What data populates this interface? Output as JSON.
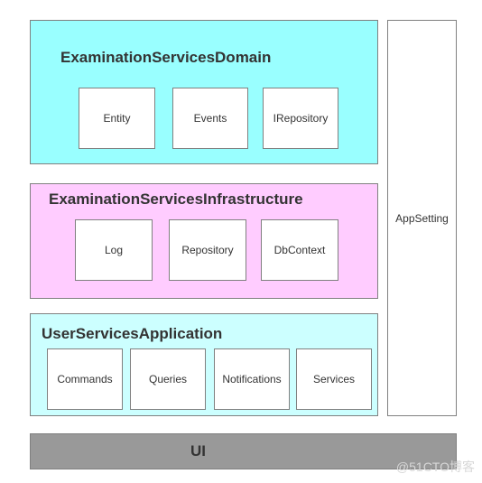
{
  "colors": {
    "domain": "#99ffff",
    "infrastructure": "#ffccff",
    "application": "#ccffff",
    "ui": "#999999",
    "border": "#808080"
  },
  "domain": {
    "title": "ExaminationServicesDomain",
    "items": [
      "Entity",
      "Events",
      "IRepository"
    ]
  },
  "infrastructure": {
    "title": "ExaminationServicesInfrastructure",
    "items": [
      "Log",
      "Repository",
      "DbContext"
    ]
  },
  "application": {
    "title": "UserServicesApplication",
    "items": [
      "Commands",
      "Queries",
      "Notifications",
      "Services"
    ]
  },
  "appsetting": {
    "label": "AppSetting"
  },
  "ui": {
    "label": "UI"
  },
  "watermark": "@51CTO博客"
}
